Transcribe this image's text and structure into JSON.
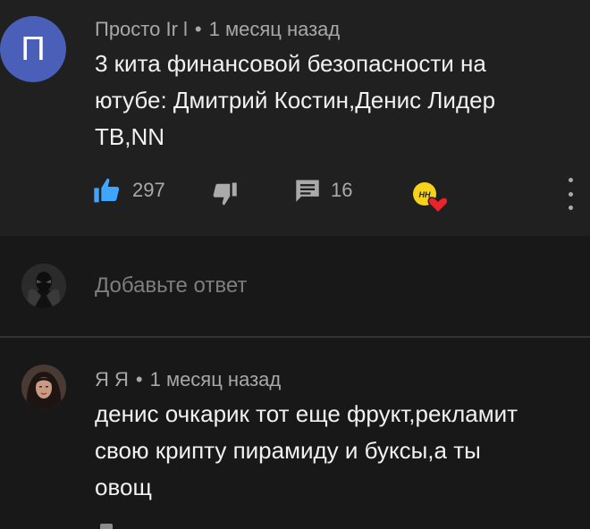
{
  "comment": {
    "avatar_letter": "П",
    "author": "Просто Ir l",
    "separator": "•",
    "time": "1 месяц назад",
    "lines": [
      "3 кита финансовой безопасности на",
      "ютубе: Дмитрий Костин,Денис Лидер",
      "ТВ,NN"
    ],
    "likes": "297",
    "replies": "16",
    "colors": {
      "avatar_bg": "#4a5fb8",
      "like_blue": "#3ea6ff",
      "heart_red": "#e8232b",
      "badge_yellow": "#f7d21b"
    },
    "icons": [
      "thumbs-up-icon",
      "thumbs-down-icon",
      "reply-icon",
      "creator-heart-icon",
      "more-vert-icon"
    ]
  },
  "reply_box": {
    "placeholder": "Добавьте ответ"
  },
  "reply": {
    "author": "Я Я",
    "separator": "•",
    "time": "1 месяц назад",
    "lines": [
      "денис очкарик тот еще фрукт,рекламит",
      "свою крипту пирамиду и буксы,а ты",
      "овощ"
    ]
  }
}
